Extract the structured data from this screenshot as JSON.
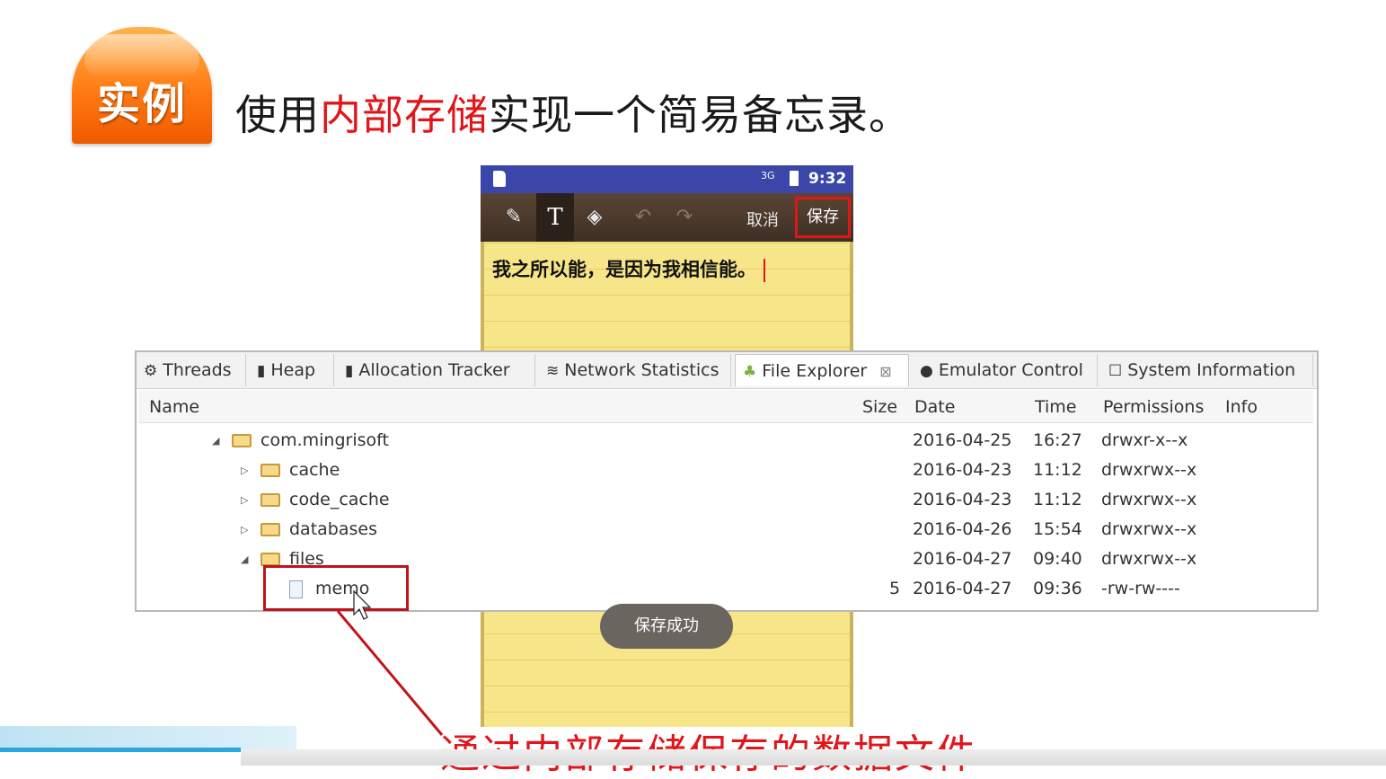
{
  "slide": {
    "badge_label": "实例",
    "heading_prefix": "使用",
    "heading_highlight": "内部存储",
    "heading_suffix": "实现一个简易备忘录。",
    "caption": "通过内部存储保存的数据文件",
    "accent_color": "#e0161b"
  },
  "phone": {
    "time": "9:32",
    "signal": "3G",
    "toolbar": {
      "pen_icon": "pen-icon",
      "text_icon_label": "T",
      "eraser_icon": "eraser-icon",
      "undo_icon": "undo-icon",
      "redo_icon": "redo-icon",
      "cancel_label": "取消",
      "save_label": "保存"
    },
    "memo_text": "我之所以能，是因为我相信能。",
    "toast": "保存成功"
  },
  "explorer": {
    "tabs": [
      {
        "label": "Threads",
        "icon": "threads-icon"
      },
      {
        "label": "Heap",
        "icon": "heap-icon"
      },
      {
        "label": "Allocation Tracker",
        "icon": "allocation-icon"
      },
      {
        "label": "Network Statistics",
        "icon": "network-icon"
      },
      {
        "label": "File Explorer",
        "icon": "android-icon",
        "active": true
      },
      {
        "label": "Emulator Control",
        "icon": "emulator-icon"
      },
      {
        "label": "System Information",
        "icon": "system-info-icon"
      }
    ],
    "close_glyph": "⊠",
    "columns": {
      "name": "Name",
      "size": "Size",
      "date": "Date",
      "time": "Time",
      "permissions": "Permissions",
      "info": "Info"
    },
    "rows": [
      {
        "name": "com.mingrisoft",
        "size": "",
        "date": "2016-04-25",
        "time": "16:27",
        "permissions": "drwxr-x--x",
        "type": "folder",
        "expanded": true
      },
      {
        "name": "cache",
        "size": "",
        "date": "2016-04-23",
        "time": "11:12",
        "permissions": "drwxrwx--x",
        "type": "folder",
        "expanded": false
      },
      {
        "name": "code_cache",
        "size": "",
        "date": "2016-04-23",
        "time": "11:12",
        "permissions": "drwxrwx--x",
        "type": "folder",
        "expanded": false
      },
      {
        "name": "databases",
        "size": "",
        "date": "2016-04-26",
        "time": "15:54",
        "permissions": "drwxrwx--x",
        "type": "folder",
        "expanded": false
      },
      {
        "name": "files",
        "size": "",
        "date": "2016-04-27",
        "time": "09:40",
        "permissions": "drwxrwx--x",
        "type": "folder",
        "expanded": true
      },
      {
        "name": "memo",
        "size": "5",
        "date": "2016-04-27",
        "time": "09:36",
        "permissions": "-rw-rw----",
        "type": "file"
      }
    ]
  }
}
